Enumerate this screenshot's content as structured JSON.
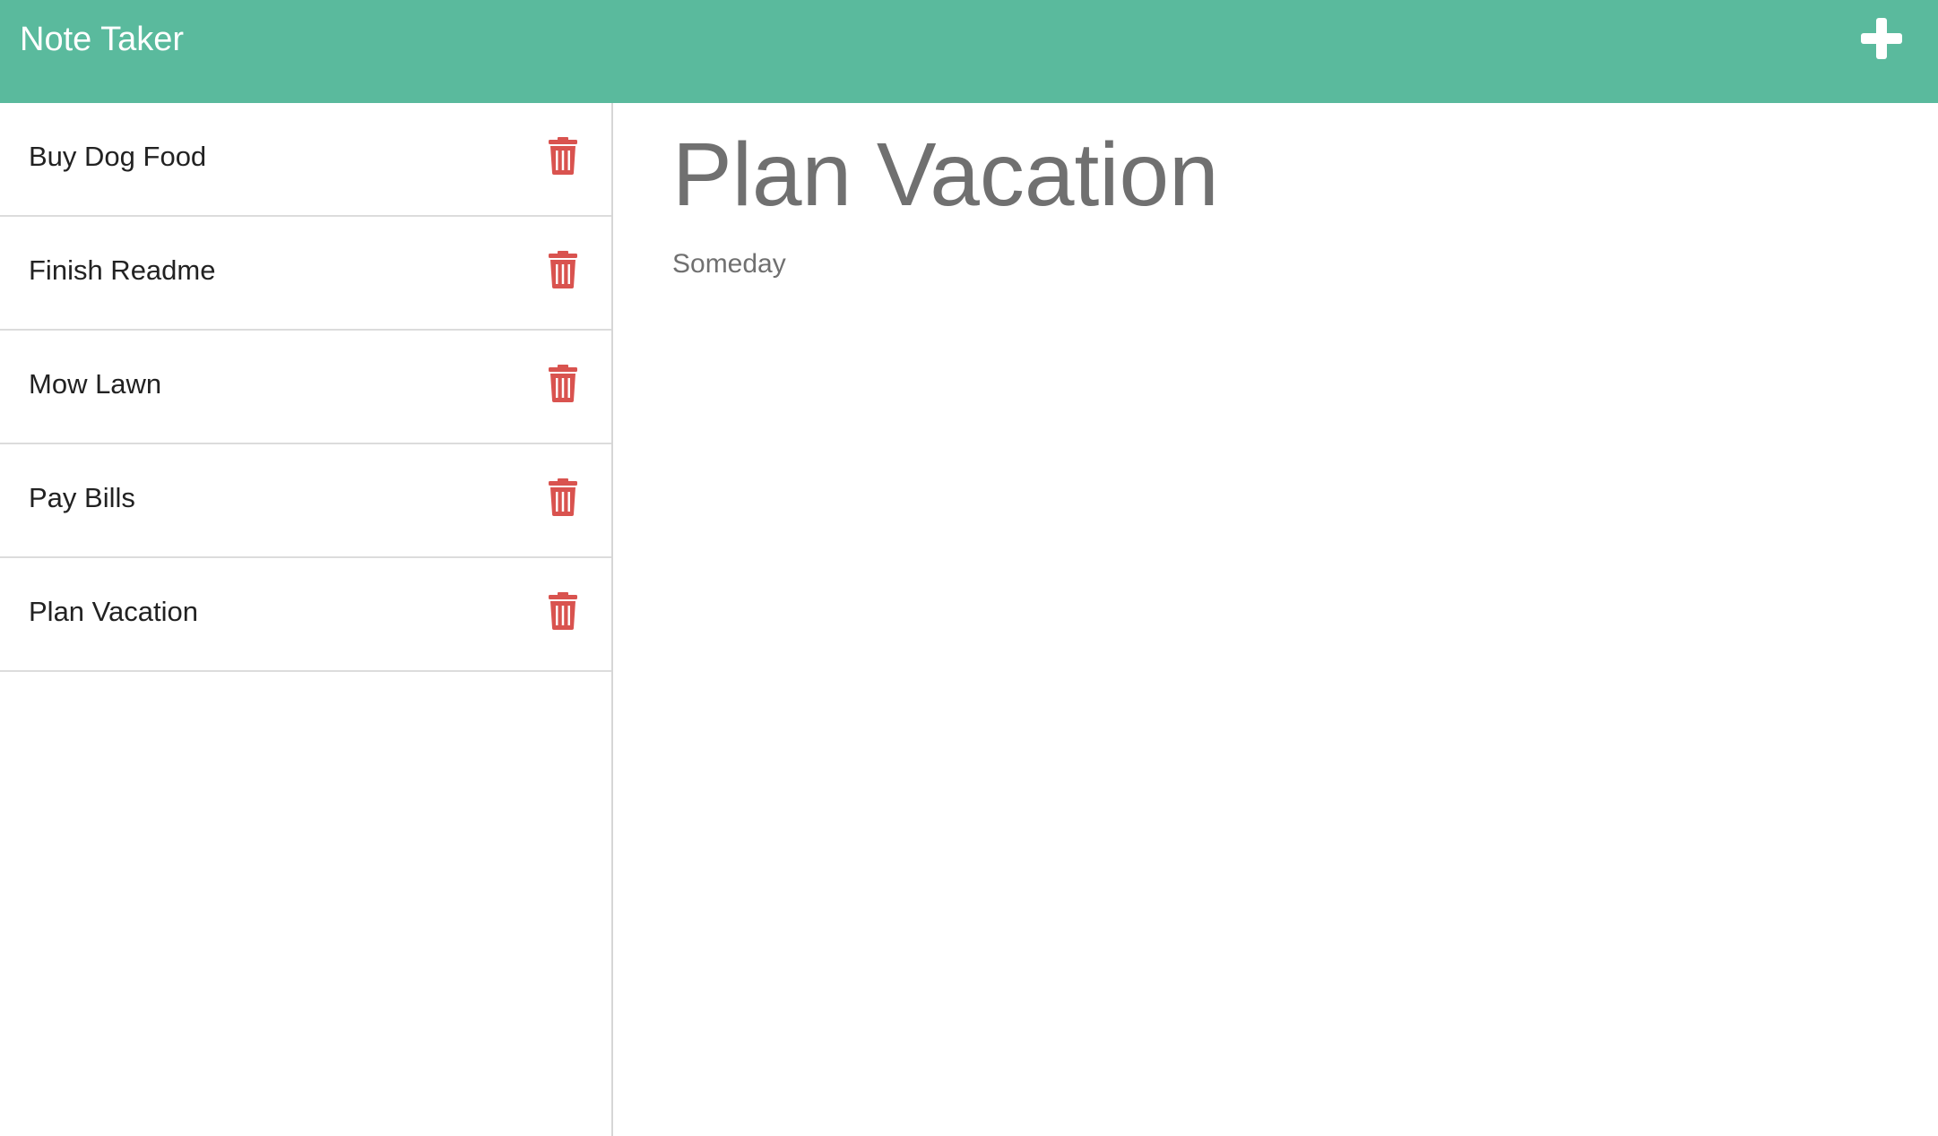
{
  "app": {
    "title": "Note Taker",
    "accent_color": "#5aba9d",
    "delete_color": "#d9534f"
  },
  "toolbar": {
    "new_note_icon": "plus-icon"
  },
  "notes": [
    {
      "title": "Buy Dog Food",
      "icon": "trash-icon"
    },
    {
      "title": "Finish Readme",
      "icon": "trash-icon"
    },
    {
      "title": "Mow Lawn",
      "icon": "trash-icon"
    },
    {
      "title": "Pay Bills",
      "icon": "trash-icon"
    },
    {
      "title": "Plan Vacation",
      "icon": "trash-icon"
    }
  ],
  "active_note": {
    "title": "Plan Vacation",
    "text": "Someday"
  }
}
